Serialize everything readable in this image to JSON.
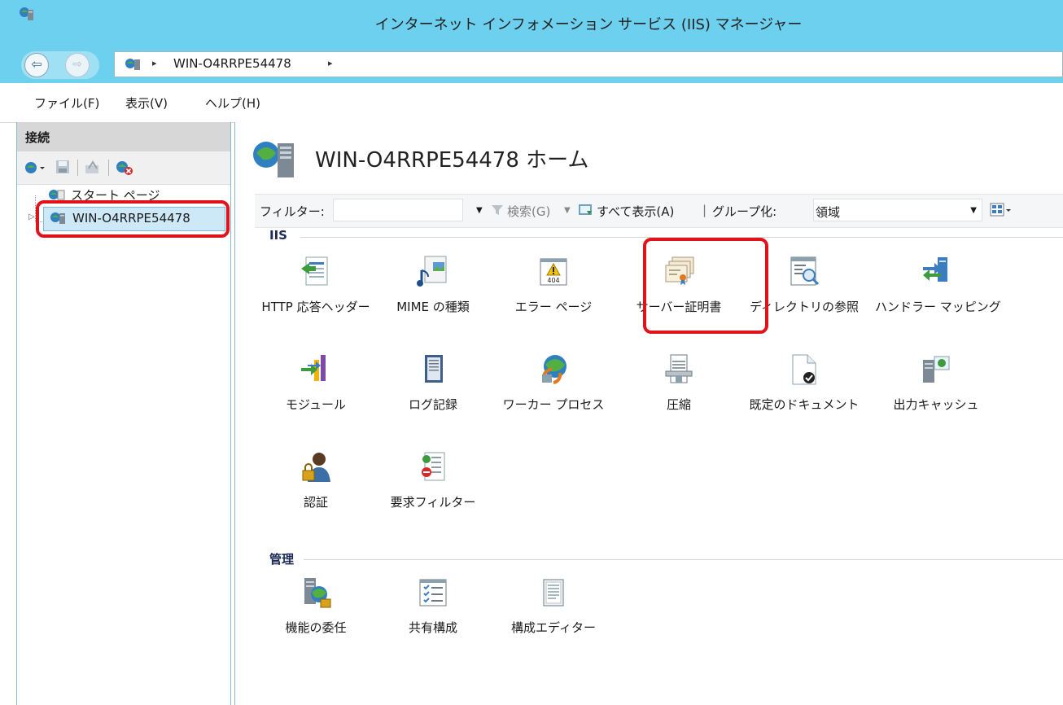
{
  "window": {
    "title": "インターネット インフォメーション サービス (IIS) マネージャー"
  },
  "address": {
    "path": "WIN-O4RRPE54478",
    "separator": "▸"
  },
  "menu": {
    "items": [
      "ファイル(F)",
      "表示(V)",
      "ヘルプ(H)"
    ]
  },
  "connections": {
    "header": "接続",
    "tree": [
      {
        "label": "スタート ページ",
        "icon": "start-page-icon"
      },
      {
        "label": "WIN-O4RRPE54478",
        "icon": "server-icon",
        "selected": true
      }
    ]
  },
  "main": {
    "title": "WIN-O4RRPE54478 ホーム",
    "filter": {
      "label": "フィルター:",
      "value": "",
      "search": "検索(G)",
      "show_all": "すべて表示(A)",
      "group_label": "グループ化:",
      "group_value": "領域"
    },
    "sections": [
      {
        "name": "IIS",
        "features": [
          {
            "label": "HTTP 応答ヘッダー",
            "icon": "http-response-headers-icon"
          },
          {
            "label": "MIME の種類",
            "icon": "mime-types-icon"
          },
          {
            "label": "エラー ページ",
            "icon": "error-pages-icon",
            "badge": "404"
          },
          {
            "label": "サーバー証明書",
            "icon": "server-certificates-icon",
            "highlighted": true
          },
          {
            "label": "ディレクトリの参照",
            "icon": "directory-browsing-icon"
          },
          {
            "label": "ハンドラー マッピング",
            "icon": "handler-mappings-icon"
          },
          {
            "label": "モジュール",
            "icon": "modules-icon"
          },
          {
            "label": "ログ記録",
            "icon": "logging-icon"
          },
          {
            "label": "ワーカー プロセス",
            "icon": "worker-processes-icon"
          },
          {
            "label": "圧縮",
            "icon": "compression-icon"
          },
          {
            "label": "既定のドキュメント",
            "icon": "default-document-icon"
          },
          {
            "label": "出力キャッシュ",
            "icon": "output-caching-icon"
          },
          {
            "label": "認証",
            "icon": "authentication-icon"
          },
          {
            "label": "要求フィルター",
            "icon": "request-filtering-icon"
          }
        ]
      },
      {
        "name": "管理",
        "features": [
          {
            "label": "機能の委任",
            "icon": "feature-delegation-icon"
          },
          {
            "label": "共有構成",
            "icon": "shared-configuration-icon"
          },
          {
            "label": "構成エディター",
            "icon": "configuration-editor-icon"
          }
        ]
      }
    ]
  },
  "colors": {
    "titlebar": "#6dd0ee",
    "highlight": "#e0131d",
    "selection": "#cde8f7"
  }
}
